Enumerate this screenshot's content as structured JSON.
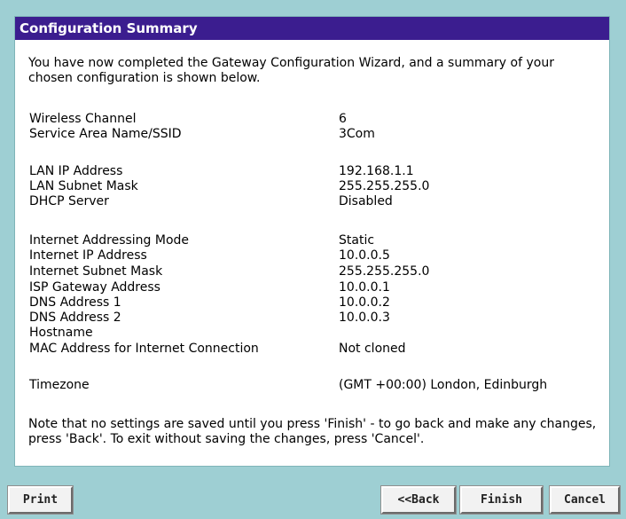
{
  "header": {
    "title": "Configuration Summary"
  },
  "intro": "You have now completed the Gateway Configuration Wizard, and a summary of your chosen configuration is shown below.",
  "groups": {
    "wireless": [
      {
        "label": "Wireless Channel",
        "value": "6"
      },
      {
        "label": "Service Area Name/SSID",
        "value": "3Com"
      }
    ],
    "lan": [
      {
        "label": "LAN IP Address",
        "value": "192.168.1.1"
      },
      {
        "label": "LAN Subnet Mask",
        "value": "255.255.255.0"
      },
      {
        "label": "DHCP Server",
        "value": "Disabled"
      }
    ],
    "internet": [
      {
        "label": "Internet Addressing Mode",
        "value": "Static"
      },
      {
        "label": "Internet IP Address",
        "value": "10.0.0.5"
      },
      {
        "label": "Internet Subnet Mask",
        "value": "255.255.255.0"
      },
      {
        "label": "ISP Gateway Address",
        "value": "10.0.0.1"
      },
      {
        "label": "DNS Address 1",
        "value": "10.0.0.2"
      },
      {
        "label": "DNS Address 2",
        "value": "10.0.0.3"
      },
      {
        "label": "Hostname",
        "value": ""
      },
      {
        "label": "MAC Address for Internet Connection",
        "value": "Not cloned"
      }
    ],
    "time": [
      {
        "label": "Timezone",
        "value": "(GMT +00:00) London, Edinburgh"
      }
    ]
  },
  "note": "Note that no settings are saved until you press 'Finish' - to go back and make any changes, press 'Back'. To exit without saving the changes, press 'Cancel'.",
  "buttons": {
    "print": "Print",
    "back": "<<Back",
    "finish": "Finish",
    "cancel": "Cancel"
  },
  "colors": {
    "title_bar": "#3b1d8f",
    "background": "#9ecfd3",
    "panel": "#ffffff"
  }
}
